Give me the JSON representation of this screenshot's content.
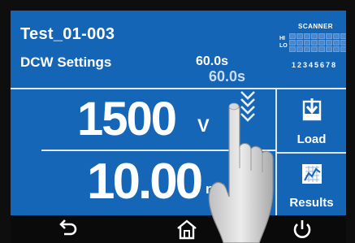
{
  "header": {
    "title": "Test_01-003",
    "mode_label": "DCW  Settings",
    "test_time": "60.0s",
    "test_time_dragging": "60.0s"
  },
  "scanner": {
    "title": "SCANNER",
    "hi_label": "HI",
    "lo_label": "LO",
    "channels": "12345678"
  },
  "readings": {
    "voltage_value": "1500",
    "voltage_unit": "V",
    "current_value": "10.00",
    "current_unit": "mA"
  },
  "buttons": {
    "load_label": "Load",
    "results_label": "Results"
  },
  "nav": {
    "icons": [
      "back-icon",
      "home-icon",
      "power-icon"
    ]
  },
  "colors": {
    "screen_blue": "#1565b6",
    "divider": "#dfe9f5",
    "nav_bar": "#0a0a0a"
  }
}
